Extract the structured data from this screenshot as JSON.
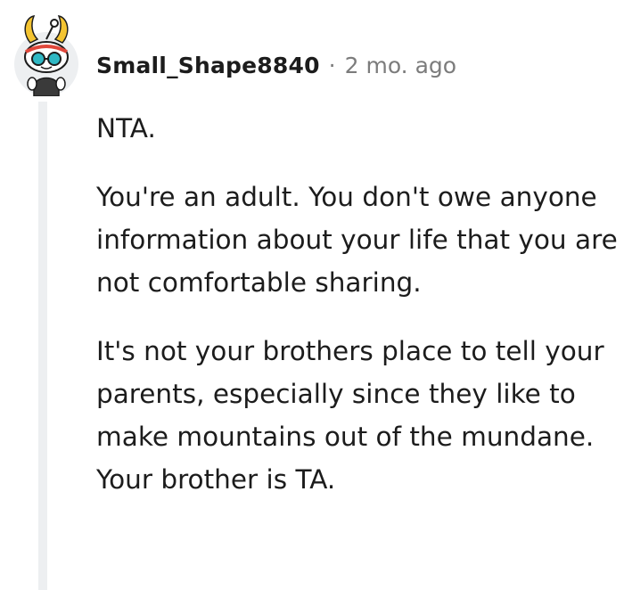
{
  "comment": {
    "author": "Small_Shape8840",
    "separator": "·",
    "timestamp": "2 mo. ago",
    "avatar_icon": "snoo-avatar-icon",
    "paragraphs": [
      "NTA.",
      "You're an adult. You don't owe anyone information about your life that you are not comfortable sharing.",
      "It's not your brothers place to tell your parents, especially since they like to make mountains out of the mundane. Your brother is TA."
    ]
  },
  "colors": {
    "text": "#1c1c1c",
    "meta_text": "#7c7c7c",
    "thread_line": "#edeff1",
    "background": "#ffffff"
  }
}
